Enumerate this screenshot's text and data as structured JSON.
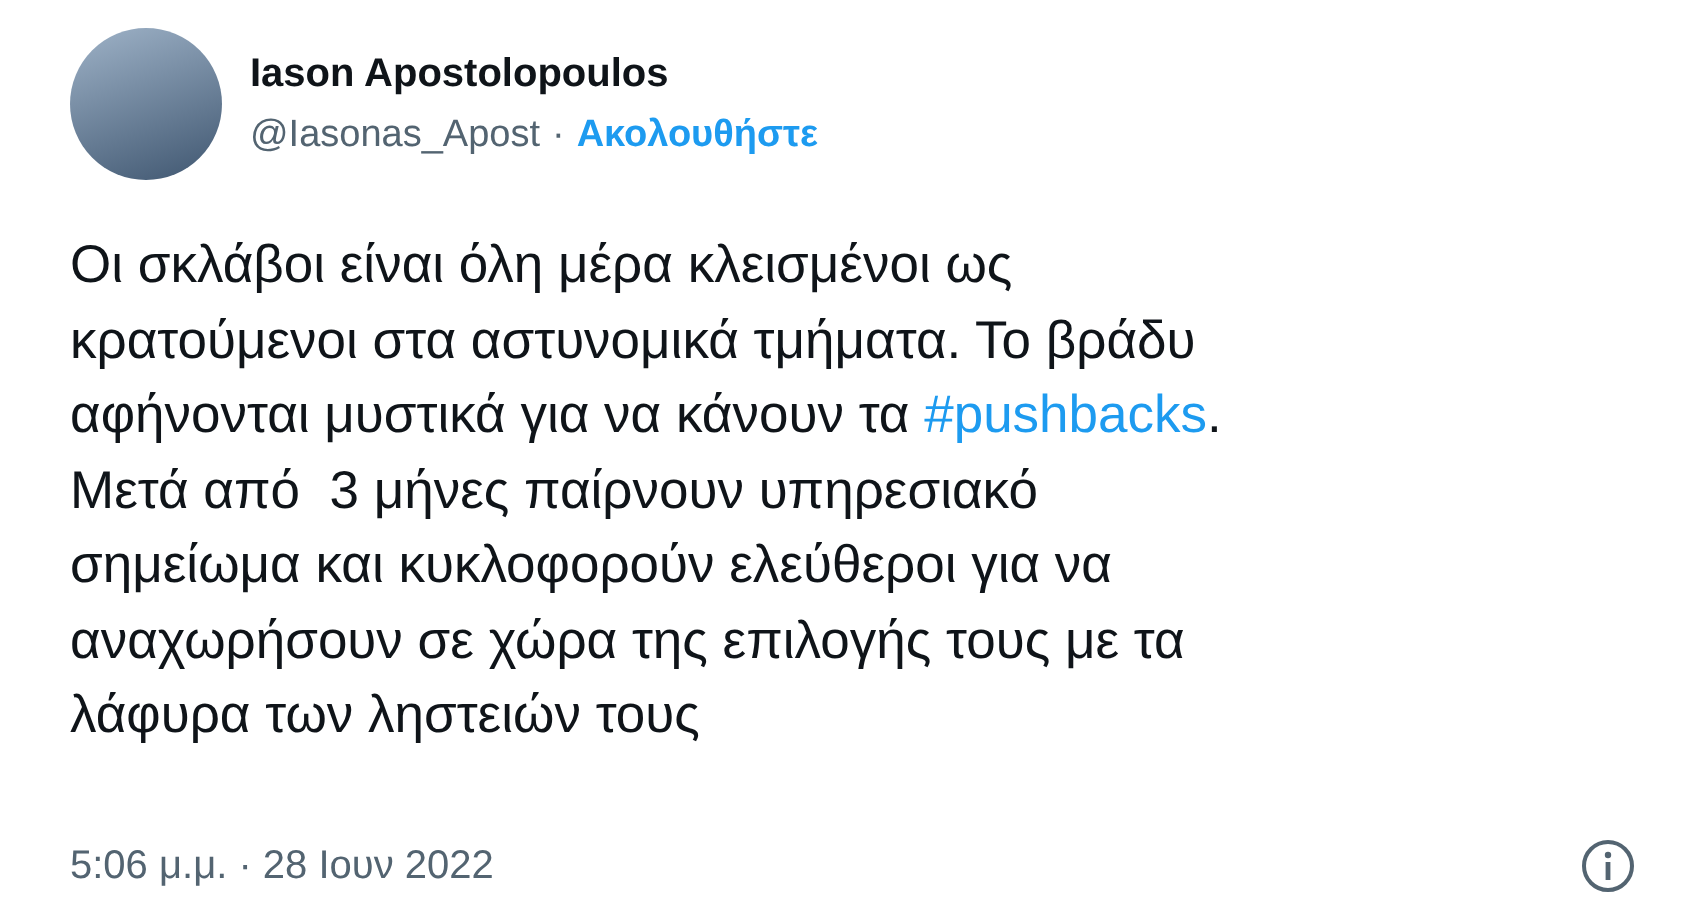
{
  "author": {
    "name": "Iason Apostolopoulos",
    "handle": "@Iasonas_Apost",
    "separator": "·",
    "follow": "Ακολουθήστε"
  },
  "body": [
    {
      "kind": "text",
      "text": "Οι σκλάβοι είναι όλη μέρα κλεισμένοι ως\nκρατούμενοι στα αστυνομικά τμήματα. Το βράδυ\nαφήνονται μυστικά για να κάνουν τα "
    },
    {
      "kind": "hashtag",
      "text": "#pushbacks"
    },
    {
      "kind": "text",
      "text": ".\nΜετά από  3 μήνες παίρνουν υπηρεσιακό\nσημείωμα και κυκλοφορούν ελεύθεροι για να\nαναχωρήσουν σε χώρα της επιλογής τους με τα\nλάφυρα των ληστειών τους"
    }
  ],
  "timestamp": "5:06 μ.μ. · 28 Ιουν 2022"
}
